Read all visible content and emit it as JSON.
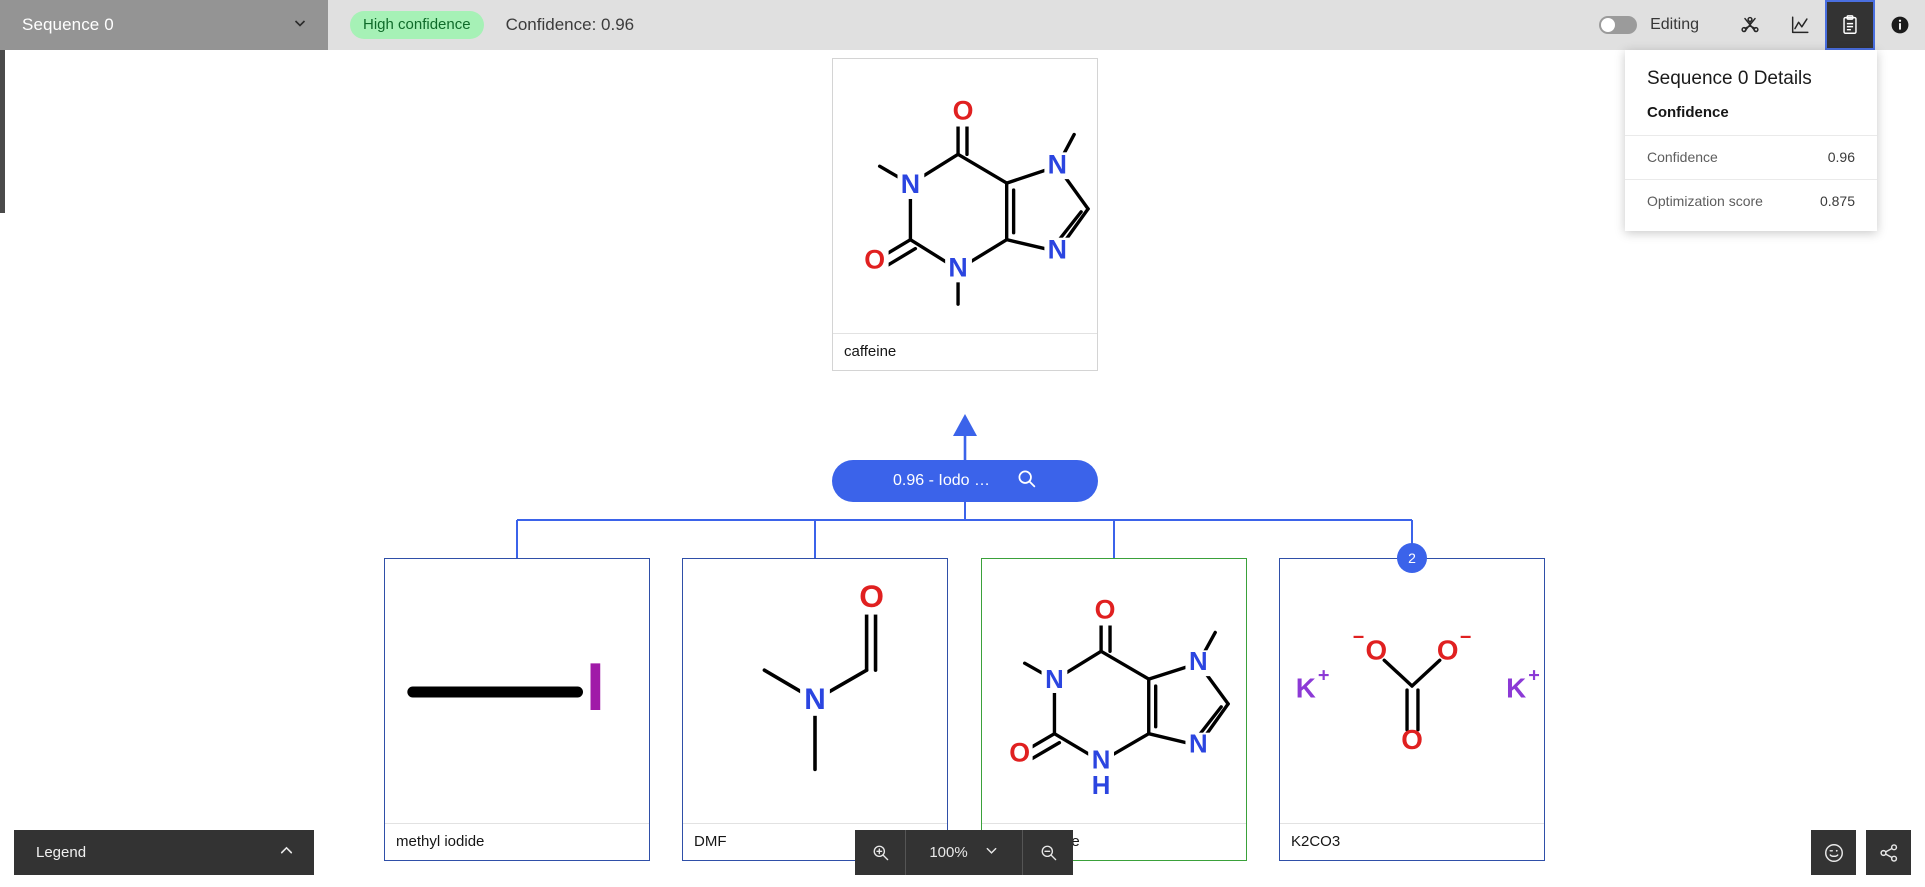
{
  "topbar": {
    "sequence_select": {
      "value": "Sequence 0",
      "chevron_icon": "chevron-down-icon"
    },
    "confidence_badge": "High confidence",
    "confidence_text": "Confidence: 0.96",
    "editing_toggle": {
      "label": "Editing",
      "state": "off"
    },
    "icons": [
      {
        "name": "network-graph-icon",
        "active": false
      },
      {
        "name": "line-chart-icon",
        "active": false
      },
      {
        "name": "clipboard-icon",
        "active": true
      },
      {
        "name": "info-icon",
        "active": false
      }
    ]
  },
  "details_panel": {
    "title": "Sequence 0 Details",
    "section": "Confidence",
    "rows": [
      {
        "key": "Confidence",
        "value": "0.96"
      },
      {
        "key": "Optimization score",
        "value": "0.875"
      }
    ]
  },
  "tree": {
    "target": {
      "label": "caffeine",
      "type": "target"
    },
    "reaction": {
      "label": "0.96 - Iodo …",
      "search_icon": "search-icon"
    },
    "precursors": [
      {
        "label": "methyl iodide",
        "border": "blue",
        "badge": null
      },
      {
        "label": "DMF",
        "border": "blue",
        "badge": null
      },
      {
        "label": "paraxanthine",
        "border": "green",
        "badge": null
      },
      {
        "label": "K2CO3",
        "border": "blue",
        "badge": "2"
      }
    ]
  },
  "legend": {
    "label": "Legend",
    "chevron_icon": "chevron-up-icon"
  },
  "zoom_controls": {
    "zoom_in_icon": "zoom-in-icon",
    "level": "100%",
    "chevron_icon": "chevron-down-icon",
    "zoom_out_icon": "zoom-out-icon"
  },
  "corner_buttons": [
    {
      "name": "feedback-smiley-icon"
    },
    {
      "name": "share-icon"
    }
  ],
  "colors": {
    "accent_blue": "#3b63ea",
    "card_border_blue": "#2f4fa8",
    "available_green": "#3aa13a",
    "badge_green_bg": "#a6f1b6",
    "badge_green_text": "#0f6b2a",
    "atom_oxygen": "#e02020",
    "atom_nitrogen": "#2b45e0",
    "atom_iodine": "#a01aa8",
    "atom_potassium": "#8c3ad6",
    "dark_panel": "#333333"
  }
}
